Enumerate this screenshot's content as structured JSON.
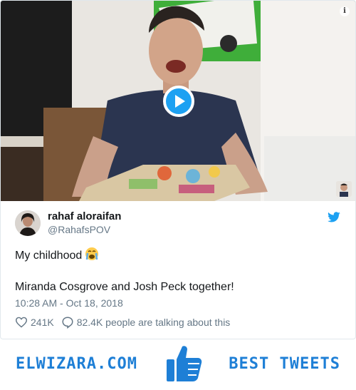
{
  "tweet": {
    "display_name": "rahaf aloraifan",
    "handle": "@RahafsPOV",
    "line1": "My childhood",
    "line2": "Miranda Cosgrove and Josh Peck together!",
    "timestamp": "10:28 AM - Oct 18, 2018",
    "likes": "241K",
    "talking": "82.4K people are talking about this"
  },
  "media": {
    "play_icon": "play-icon",
    "info_icon": "info-icon",
    "info_glyph": "i"
  },
  "footer": {
    "brand": "ELWIZARA.COM",
    "tagline": "BEST TWEETS",
    "icon": "thumbs-up-icon"
  },
  "colors": {
    "twitter_blue": "#1da1f2",
    "brand_blue": "#1e7fd6",
    "muted": "#657786"
  }
}
